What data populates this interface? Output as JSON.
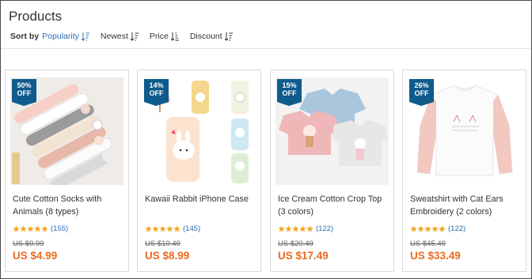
{
  "page": {
    "title": "Products"
  },
  "sort": {
    "label": "Sort by",
    "options": [
      {
        "label": "Popularity",
        "active": true
      },
      {
        "label": "Newest",
        "active": false
      },
      {
        "label": "Price",
        "active": false
      },
      {
        "label": "Discount",
        "active": false
      }
    ]
  },
  "products": [
    {
      "discount_line1": "50%",
      "discount_line2": "OFF",
      "name": "Cute Cotton Socks with Animals (8 types)",
      "rating": 5,
      "reviews": "(155)",
      "old_price": "US $9.99",
      "price": "US $4.99",
      "image": "socks-image"
    },
    {
      "discount_line1": "14%",
      "discount_line2": "OFF",
      "name": "Kawaii Rabbit iPhone Case",
      "rating": 5,
      "reviews": "(145)",
      "old_price": "US $10.49",
      "price": "US $8.99",
      "image": "phone-case-image"
    },
    {
      "discount_line1": "15%",
      "discount_line2": "OFF",
      "name": "Ice Cream Cotton Crop Top (3 colors)",
      "rating": 5,
      "reviews": "(122)",
      "old_price": "US $20.49",
      "price": "US $17.49",
      "image": "crop-top-image"
    },
    {
      "discount_line1": "26%",
      "discount_line2": "OFF",
      "name": "Sweatshirt with Cat Ears Embroidery (2 colors)",
      "rating": 5,
      "reviews": "(122)",
      "old_price": "US $45.49",
      "price": "US $33.49",
      "image": "sweatshirt-image"
    }
  ],
  "colors": {
    "accent": "#2a6db3",
    "price": "#ea6a22",
    "ribbon": "#0f5b8c",
    "star": "#f5a623"
  }
}
